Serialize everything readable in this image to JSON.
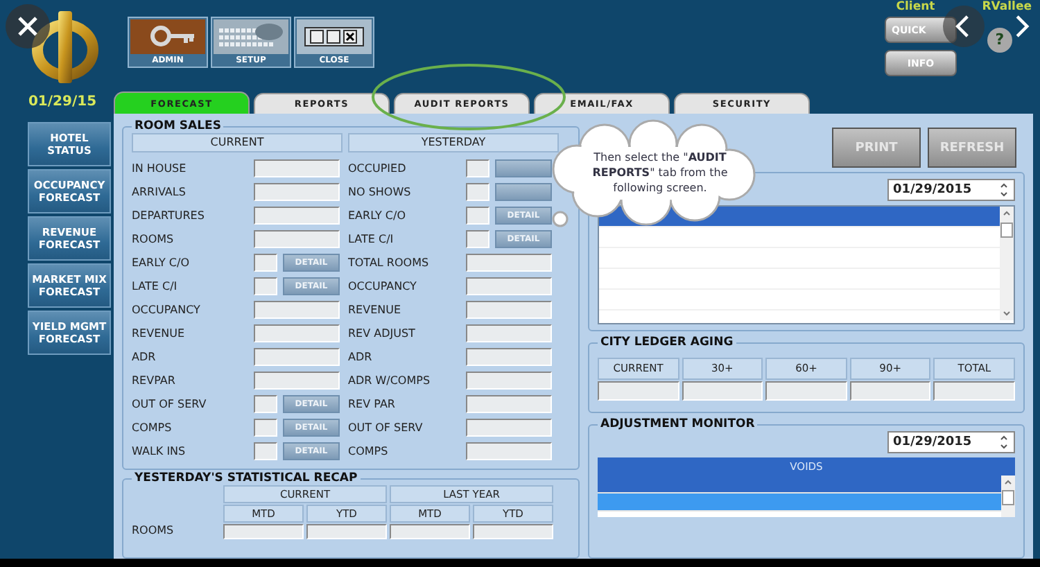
{
  "header": {
    "date": "01/29/15",
    "client_label": "Client",
    "user": "RVallee"
  },
  "toolbar": [
    {
      "label": "ADMIN",
      "kind": "key"
    },
    {
      "label": "SETUP",
      "kind": "keyboard"
    },
    {
      "label": "CLOSE",
      "kind": "window"
    }
  ],
  "quick_buttons": [
    "QUICK",
    "INFO"
  ],
  "help": "?",
  "tabs": [
    {
      "label": "FORECAST",
      "selected": true
    },
    {
      "label": "REPORTS",
      "selected": false
    },
    {
      "label": "AUDIT REPORTS",
      "selected": false
    },
    {
      "label": "EMAIL/FAX",
      "selected": false
    },
    {
      "label": "SECURITY",
      "selected": false
    }
  ],
  "sidebar": {
    "items": [
      {
        "lines": [
          "HOTEL",
          "STATUS"
        ]
      },
      {
        "lines": [
          "OCCUPANCY",
          "FORECAST"
        ]
      },
      {
        "lines": [
          "REVENUE",
          "FORECAST"
        ]
      },
      {
        "lines": [
          "MARKET MIX",
          "FORECAST"
        ]
      },
      {
        "lines": [
          "YIELD MGMT",
          "FORECAST"
        ]
      }
    ]
  },
  "room_sales": {
    "title": "ROOM SALES",
    "columns": [
      "CURRENT",
      "YESTERDAY"
    ],
    "current": [
      {
        "label": "IN HOUSE",
        "kind": "field"
      },
      {
        "label": "ARRIVALS",
        "kind": "field"
      },
      {
        "label": "DEPARTURES",
        "kind": "field"
      },
      {
        "label": "ROOMS",
        "kind": "field"
      },
      {
        "label": "EARLY C/O",
        "kind": "detail",
        "button": "DETAIL"
      },
      {
        "label": "LATE C/I",
        "kind": "detail",
        "button": "DETAIL"
      },
      {
        "label": "OCCUPANCY",
        "kind": "field"
      },
      {
        "label": "REVENUE",
        "kind": "field"
      },
      {
        "label": "ADR",
        "kind": "field"
      },
      {
        "label": "REVPAR",
        "kind": "field"
      },
      {
        "label": "OUT OF SERV",
        "kind": "detail",
        "button": "DETAIL"
      },
      {
        "label": "COMPS",
        "kind": "detail",
        "button": "DETAIL"
      },
      {
        "label": "WALK INS",
        "kind": "detail",
        "button": "DETAIL"
      }
    ],
    "yesterday": [
      {
        "label": "OCCUPIED",
        "kind": "detail"
      },
      {
        "label": "NO SHOWS",
        "kind": "detail"
      },
      {
        "label": "EARLY C/O",
        "kind": "detail",
        "button": "DETAIL"
      },
      {
        "label": "LATE C/I",
        "kind": "detail",
        "button": "DETAIL"
      },
      {
        "label": "TOTAL ROOMS",
        "kind": "field"
      },
      {
        "label": "OCCUPANCY",
        "kind": "field"
      },
      {
        "label": "REVENUE",
        "kind": "field"
      },
      {
        "label": "REV ADJUST",
        "kind": "field"
      },
      {
        "label": "ADR",
        "kind": "field"
      },
      {
        "label": "ADR W/COMPS",
        "kind": "field"
      },
      {
        "label": "REV PAR",
        "kind": "field"
      },
      {
        "label": "OUT OF SERV",
        "kind": "field"
      },
      {
        "label": "COMPS",
        "kind": "field"
      }
    ]
  },
  "recap": {
    "title": "YESTERDAY'S STATISTICAL RECAP",
    "groups": [
      "CURRENT",
      "LAST YEAR"
    ],
    "subcolumns": [
      "MTD",
      "YTD",
      "MTD",
      "YTD"
    ],
    "rows": [
      "ROOMS"
    ]
  },
  "callout": {
    "text": "Then select the \"**AUDIT REPORTS**\" tab from the following screen."
  },
  "actions": [
    "PRINT",
    "REFRESH"
  ],
  "report_list": {
    "date": "01/29/2015",
    "rows": [
      {
        "selected": true
      },
      {
        "selected": false
      },
      {
        "selected": false
      },
      {
        "selected": false
      },
      {
        "selected": false
      }
    ]
  },
  "city_ledger": {
    "title": "CITY LEDGER AGING",
    "columns": [
      "CURRENT",
      "30+",
      "60+",
      "90+",
      "TOTAL"
    ]
  },
  "adjustment_monitor": {
    "title": "ADJUSTMENT MONITOR",
    "date": "01/29/2015",
    "header": "VOIDS",
    "rows": [
      {
        "selected": true,
        "highlighted": false
      },
      {
        "selected": false,
        "highlighted": true
      }
    ]
  }
}
